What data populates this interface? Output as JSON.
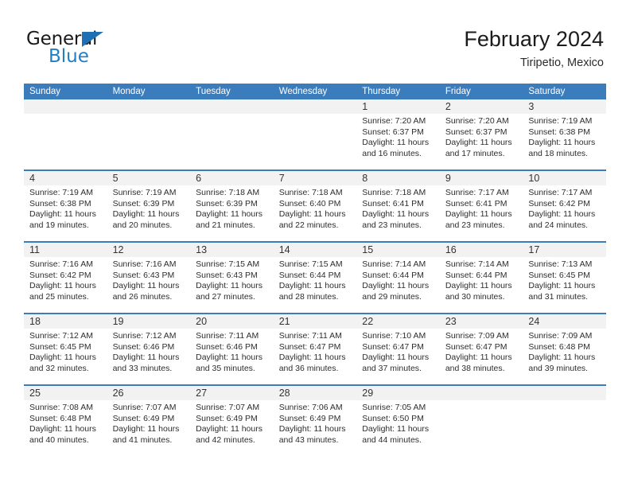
{
  "brand": {
    "name_top": "General",
    "name_bottom": "Blue",
    "accent_color": "#1f7fc4"
  },
  "header": {
    "title": "February 2024",
    "subtitle": "Tiripetio, Mexico"
  },
  "calendar": {
    "header_bg": "#3b7cbd",
    "daynum_bg": "#f2f2f2",
    "weekdays": [
      "Sunday",
      "Monday",
      "Tuesday",
      "Wednesday",
      "Thursday",
      "Friday",
      "Saturday"
    ],
    "weeks": [
      [
        {
          "day": "",
          "sunrise": "",
          "sunset": "",
          "daylight_1": "",
          "daylight_2": ""
        },
        {
          "day": "",
          "sunrise": "",
          "sunset": "",
          "daylight_1": "",
          "daylight_2": ""
        },
        {
          "day": "",
          "sunrise": "",
          "sunset": "",
          "daylight_1": "",
          "daylight_2": ""
        },
        {
          "day": "",
          "sunrise": "",
          "sunset": "",
          "daylight_1": "",
          "daylight_2": ""
        },
        {
          "day": "1",
          "sunrise": "Sunrise: 7:20 AM",
          "sunset": "Sunset: 6:37 PM",
          "daylight_1": "Daylight: 11 hours",
          "daylight_2": "and 16 minutes."
        },
        {
          "day": "2",
          "sunrise": "Sunrise: 7:20 AM",
          "sunset": "Sunset: 6:37 PM",
          "daylight_1": "Daylight: 11 hours",
          "daylight_2": "and 17 minutes."
        },
        {
          "day": "3",
          "sunrise": "Sunrise: 7:19 AM",
          "sunset": "Sunset: 6:38 PM",
          "daylight_1": "Daylight: 11 hours",
          "daylight_2": "and 18 minutes."
        }
      ],
      [
        {
          "day": "4",
          "sunrise": "Sunrise: 7:19 AM",
          "sunset": "Sunset: 6:38 PM",
          "daylight_1": "Daylight: 11 hours",
          "daylight_2": "and 19 minutes."
        },
        {
          "day": "5",
          "sunrise": "Sunrise: 7:19 AM",
          "sunset": "Sunset: 6:39 PM",
          "daylight_1": "Daylight: 11 hours",
          "daylight_2": "and 20 minutes."
        },
        {
          "day": "6",
          "sunrise": "Sunrise: 7:18 AM",
          "sunset": "Sunset: 6:39 PM",
          "daylight_1": "Daylight: 11 hours",
          "daylight_2": "and 21 minutes."
        },
        {
          "day": "7",
          "sunrise": "Sunrise: 7:18 AM",
          "sunset": "Sunset: 6:40 PM",
          "daylight_1": "Daylight: 11 hours",
          "daylight_2": "and 22 minutes."
        },
        {
          "day": "8",
          "sunrise": "Sunrise: 7:18 AM",
          "sunset": "Sunset: 6:41 PM",
          "daylight_1": "Daylight: 11 hours",
          "daylight_2": "and 23 minutes."
        },
        {
          "day": "9",
          "sunrise": "Sunrise: 7:17 AM",
          "sunset": "Sunset: 6:41 PM",
          "daylight_1": "Daylight: 11 hours",
          "daylight_2": "and 23 minutes."
        },
        {
          "day": "10",
          "sunrise": "Sunrise: 7:17 AM",
          "sunset": "Sunset: 6:42 PM",
          "daylight_1": "Daylight: 11 hours",
          "daylight_2": "and 24 minutes."
        }
      ],
      [
        {
          "day": "11",
          "sunrise": "Sunrise: 7:16 AM",
          "sunset": "Sunset: 6:42 PM",
          "daylight_1": "Daylight: 11 hours",
          "daylight_2": "and 25 minutes."
        },
        {
          "day": "12",
          "sunrise": "Sunrise: 7:16 AM",
          "sunset": "Sunset: 6:43 PM",
          "daylight_1": "Daylight: 11 hours",
          "daylight_2": "and 26 minutes."
        },
        {
          "day": "13",
          "sunrise": "Sunrise: 7:15 AM",
          "sunset": "Sunset: 6:43 PM",
          "daylight_1": "Daylight: 11 hours",
          "daylight_2": "and 27 minutes."
        },
        {
          "day": "14",
          "sunrise": "Sunrise: 7:15 AM",
          "sunset": "Sunset: 6:44 PM",
          "daylight_1": "Daylight: 11 hours",
          "daylight_2": "and 28 minutes."
        },
        {
          "day": "15",
          "sunrise": "Sunrise: 7:14 AM",
          "sunset": "Sunset: 6:44 PM",
          "daylight_1": "Daylight: 11 hours",
          "daylight_2": "and 29 minutes."
        },
        {
          "day": "16",
          "sunrise": "Sunrise: 7:14 AM",
          "sunset": "Sunset: 6:44 PM",
          "daylight_1": "Daylight: 11 hours",
          "daylight_2": "and 30 minutes."
        },
        {
          "day": "17",
          "sunrise": "Sunrise: 7:13 AM",
          "sunset": "Sunset: 6:45 PM",
          "daylight_1": "Daylight: 11 hours",
          "daylight_2": "and 31 minutes."
        }
      ],
      [
        {
          "day": "18",
          "sunrise": "Sunrise: 7:12 AM",
          "sunset": "Sunset: 6:45 PM",
          "daylight_1": "Daylight: 11 hours",
          "daylight_2": "and 32 minutes."
        },
        {
          "day": "19",
          "sunrise": "Sunrise: 7:12 AM",
          "sunset": "Sunset: 6:46 PM",
          "daylight_1": "Daylight: 11 hours",
          "daylight_2": "and 33 minutes."
        },
        {
          "day": "20",
          "sunrise": "Sunrise: 7:11 AM",
          "sunset": "Sunset: 6:46 PM",
          "daylight_1": "Daylight: 11 hours",
          "daylight_2": "and 35 minutes."
        },
        {
          "day": "21",
          "sunrise": "Sunrise: 7:11 AM",
          "sunset": "Sunset: 6:47 PM",
          "daylight_1": "Daylight: 11 hours",
          "daylight_2": "and 36 minutes."
        },
        {
          "day": "22",
          "sunrise": "Sunrise: 7:10 AM",
          "sunset": "Sunset: 6:47 PM",
          "daylight_1": "Daylight: 11 hours",
          "daylight_2": "and 37 minutes."
        },
        {
          "day": "23",
          "sunrise": "Sunrise: 7:09 AM",
          "sunset": "Sunset: 6:47 PM",
          "daylight_1": "Daylight: 11 hours",
          "daylight_2": "and 38 minutes."
        },
        {
          "day": "24",
          "sunrise": "Sunrise: 7:09 AM",
          "sunset": "Sunset: 6:48 PM",
          "daylight_1": "Daylight: 11 hours",
          "daylight_2": "and 39 minutes."
        }
      ],
      [
        {
          "day": "25",
          "sunrise": "Sunrise: 7:08 AM",
          "sunset": "Sunset: 6:48 PM",
          "daylight_1": "Daylight: 11 hours",
          "daylight_2": "and 40 minutes."
        },
        {
          "day": "26",
          "sunrise": "Sunrise: 7:07 AM",
          "sunset": "Sunset: 6:49 PM",
          "daylight_1": "Daylight: 11 hours",
          "daylight_2": "and 41 minutes."
        },
        {
          "day": "27",
          "sunrise": "Sunrise: 7:07 AM",
          "sunset": "Sunset: 6:49 PM",
          "daylight_1": "Daylight: 11 hours",
          "daylight_2": "and 42 minutes."
        },
        {
          "day": "28",
          "sunrise": "Sunrise: 7:06 AM",
          "sunset": "Sunset: 6:49 PM",
          "daylight_1": "Daylight: 11 hours",
          "daylight_2": "and 43 minutes."
        },
        {
          "day": "29",
          "sunrise": "Sunrise: 7:05 AM",
          "sunset": "Sunset: 6:50 PM",
          "daylight_1": "Daylight: 11 hours",
          "daylight_2": "and 44 minutes."
        },
        {
          "day": "",
          "sunrise": "",
          "sunset": "",
          "daylight_1": "",
          "daylight_2": ""
        },
        {
          "day": "",
          "sunrise": "",
          "sunset": "",
          "daylight_1": "",
          "daylight_2": ""
        }
      ]
    ]
  }
}
